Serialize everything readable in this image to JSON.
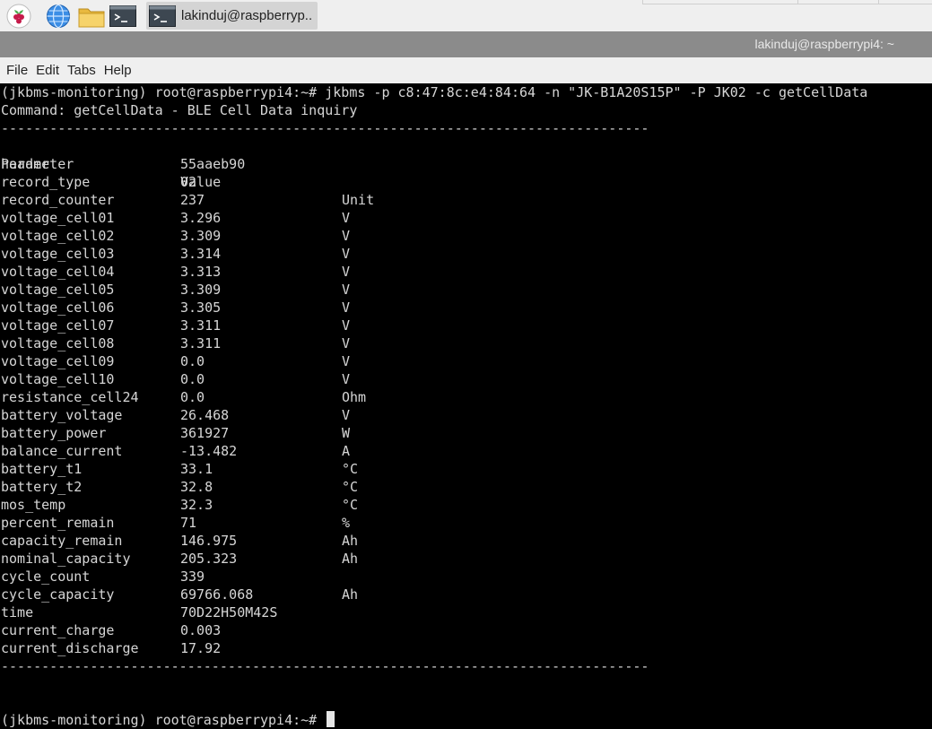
{
  "taskbar": {
    "icons": [
      "raspberry-pi-menu-icon",
      "web-browser-icon",
      "file-manager-icon",
      "terminal-icon"
    ],
    "active_task": {
      "icon": "terminal-icon",
      "label": "lakinduj@raspberryp.."
    }
  },
  "window": {
    "title": "lakinduj@raspberrypi4: ~"
  },
  "menubar": {
    "items": [
      "File",
      "Edit",
      "Tabs",
      "Help"
    ]
  },
  "terminal": {
    "prompt": "(jkbms-monitoring) root@raspberrypi4:~#",
    "command": "jkbms -p c8:47:8c:e4:84:64 -n \"JK-B1A20S15P\" -P JK02 -c getCellData",
    "command_description": "Command: getCellData - BLE Cell Data inquiry",
    "separator": "--------------------------------------------------------------------------------",
    "header": {
      "parameter": "Parameter",
      "value": "Value",
      "unit": "Unit"
    },
    "rows": [
      {
        "parameter": "header",
        "value": "55aaeb90",
        "unit": ""
      },
      {
        "parameter": "record_type",
        "value": "02",
        "unit": ""
      },
      {
        "parameter": "record_counter",
        "value": "237",
        "unit": ""
      },
      {
        "parameter": "voltage_cell01",
        "value": "3.296",
        "unit": "V"
      },
      {
        "parameter": "voltage_cell02",
        "value": "3.309",
        "unit": "V"
      },
      {
        "parameter": "voltage_cell03",
        "value": "3.314",
        "unit": "V"
      },
      {
        "parameter": "voltage_cell04",
        "value": "3.313",
        "unit": "V"
      },
      {
        "parameter": "voltage_cell05",
        "value": "3.309",
        "unit": "V"
      },
      {
        "parameter": "voltage_cell06",
        "value": "3.305",
        "unit": "V"
      },
      {
        "parameter": "voltage_cell07",
        "value": "3.311",
        "unit": "V"
      },
      {
        "parameter": "voltage_cell08",
        "value": "3.311",
        "unit": "V"
      },
      {
        "parameter": "voltage_cell09",
        "value": "0.0",
        "unit": "V"
      },
      {
        "parameter": "voltage_cell10",
        "value": "0.0",
        "unit": "V"
      },
      {
        "parameter": "resistance_cell24",
        "value": "0.0",
        "unit": "Ohm"
      },
      {
        "parameter": "battery_voltage",
        "value": "26.468",
        "unit": "V"
      },
      {
        "parameter": "battery_power",
        "value": "361927",
        "unit": "W"
      },
      {
        "parameter": "balance_current",
        "value": "-13.482",
        "unit": "A"
      },
      {
        "parameter": "battery_t1",
        "value": "33.1",
        "unit": "°C"
      },
      {
        "parameter": "battery_t2",
        "value": "32.8",
        "unit": "°C"
      },
      {
        "parameter": "mos_temp",
        "value": "32.3",
        "unit": "°C"
      },
      {
        "parameter": "percent_remain",
        "value": "71",
        "unit": "%"
      },
      {
        "parameter": "capacity_remain",
        "value": "146.975",
        "unit": "Ah"
      },
      {
        "parameter": "nominal_capacity",
        "value": "205.323",
        "unit": "Ah"
      },
      {
        "parameter": "cycle_count",
        "value": "339",
        "unit": ""
      },
      {
        "parameter": "cycle_capacity",
        "value": "69766.068",
        "unit": "Ah"
      },
      {
        "parameter": "time",
        "value": "70D22H50M42S",
        "unit": ""
      },
      {
        "parameter": "current_charge",
        "value": "0.003",
        "unit": ""
      },
      {
        "parameter": "current_discharge",
        "value": "17.92",
        "unit": ""
      }
    ]
  }
}
